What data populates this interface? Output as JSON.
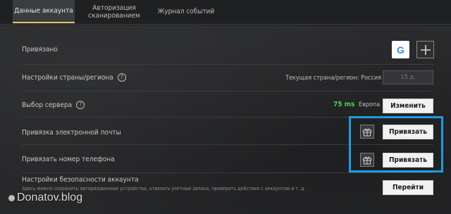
{
  "tabs": [
    {
      "label": "Данные аккаунта",
      "active": true
    },
    {
      "label": "Авторизация сканированием",
      "active": false
    },
    {
      "label": "Журнал событий",
      "active": false
    }
  ],
  "rows": {
    "linked": {
      "label": "Привязано",
      "google_letter": "G",
      "add_icon": "plus-icon"
    },
    "country": {
      "label": "Настройки страны/региона",
      "current_text": "Текущая страна/регион: Россия",
      "button_text": "15 д."
    },
    "server": {
      "label": "Выбор сервера",
      "ping": "75 ms",
      "region": "Европа",
      "button": "Изменить"
    },
    "email": {
      "label": "Привязка электронной почты",
      "button": "Привязать",
      "gift_icon": "gift-icon"
    },
    "phone": {
      "label": "Привязать номер телефона",
      "button": "Привязать",
      "gift_icon": "gift-icon"
    },
    "security": {
      "label": "Настройки безопасности аккаунта",
      "description": "Здесь можно сохранить авторизованные устройства, отвязать учетные записи, проверить действия с аккаунтом и т. д.",
      "button": "Перейти"
    }
  },
  "watermark": "Donatov.blog",
  "colors": {
    "accent_tab": "#e9c46a",
    "highlight": "#1d9ce0",
    "ping_green": "#4fd14a"
  }
}
